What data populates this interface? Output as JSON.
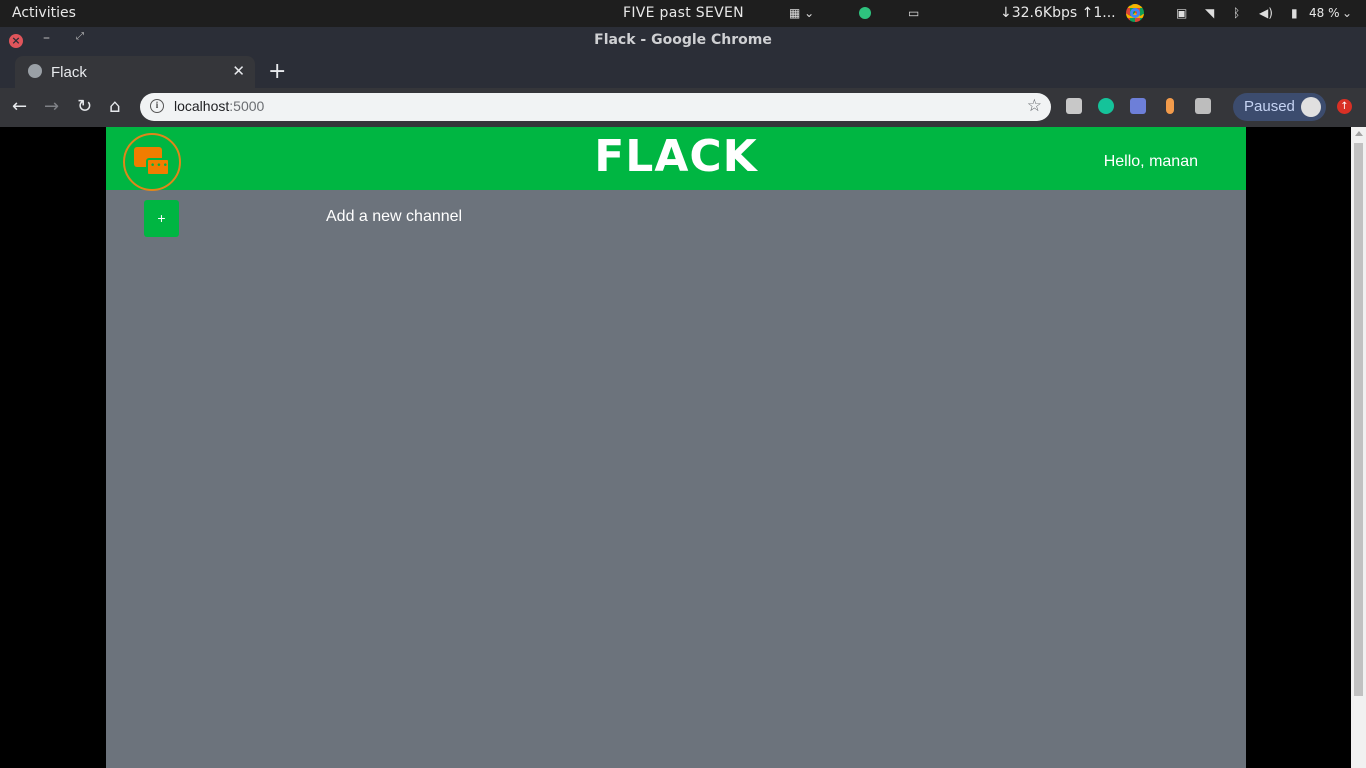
{
  "system_bar": {
    "activities": "Activities",
    "clock": "FIVE past SEVEN",
    "network_speed": "↓32.6Kbps ↑1...",
    "battery": "48 %"
  },
  "window": {
    "title": "Flack - Google Chrome"
  },
  "browser": {
    "tab_title": "Flack",
    "url_host": "localhost",
    "url_port": ":5000",
    "profile_status": "Paused"
  },
  "app": {
    "brand": "FLACK",
    "greeting": "Hello, manan",
    "add_button": "+",
    "add_label": "Add a new channel",
    "colors": {
      "navbar": "#00b642",
      "background": "#6c737c",
      "logo": "#f07d00"
    }
  }
}
